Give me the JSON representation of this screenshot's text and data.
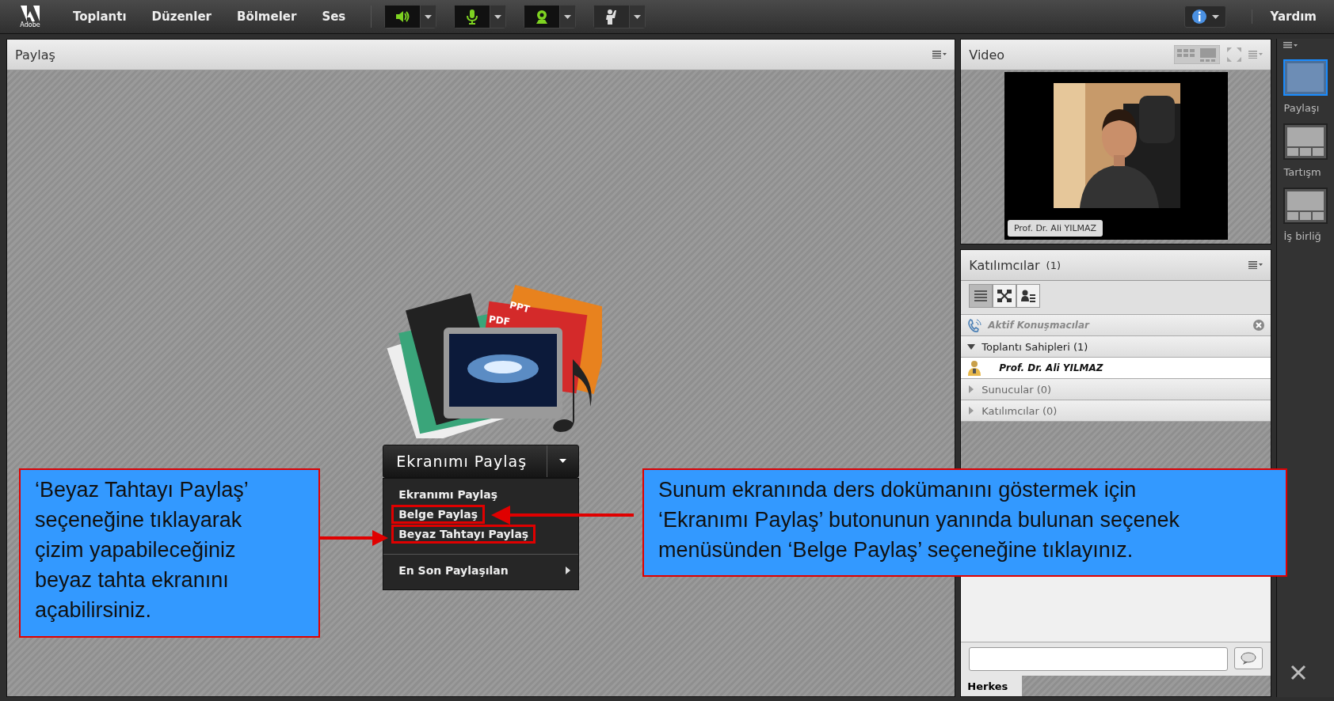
{
  "menu_bar": {
    "logo_text": "Adobe",
    "items": [
      "Toplantı",
      "Düzenler",
      "Bölmeler",
      "Ses"
    ],
    "help": "Yardım"
  },
  "toolbar": [
    {
      "kind": "speaker",
      "on": true
    },
    {
      "kind": "microphone",
      "on": true
    },
    {
      "kind": "camera",
      "on": true
    },
    {
      "kind": "hand",
      "on": false
    }
  ],
  "share_pod": {
    "title": "Paylaş",
    "media_labels": [
      "PPT",
      "PDF"
    ],
    "share_button": "Ekranımı Paylaş",
    "menu": [
      {
        "label": "Ekranımı Paylaş",
        "highlighted": false,
        "submenu": false
      },
      {
        "label": "Belge Paylaş",
        "highlighted": true,
        "submenu": false
      },
      {
        "label": "Beyaz Tahtayı Paylaş",
        "highlighted": true,
        "submenu": false
      },
      {
        "label": "En Son Paylaşılan",
        "highlighted": false,
        "submenu": true
      }
    ]
  },
  "video_pod": {
    "title": "Video",
    "name_tag": "Prof. Dr. Ali YILMAZ"
  },
  "attendees_pod": {
    "title": "Katılımcılar",
    "count": "(1)",
    "view_tabs": [
      {
        "kind": "list",
        "selected": true
      },
      {
        "kind": "breakout",
        "selected": false
      },
      {
        "kind": "detail",
        "selected": false
      }
    ],
    "active_speakers": "Aktif Konuşmacılar",
    "groups": [
      {
        "label": "Toplantı Sahipleri (1)",
        "expanded": true,
        "children": [
          {
            "label": "Prof. Dr. Ali YILMAZ"
          }
        ]
      },
      {
        "label": "Sunucular (0)",
        "expanded": false
      },
      {
        "label": "Katılımcılar (0)",
        "expanded": false
      }
    ],
    "chat_tab": "Herkes"
  },
  "layouts": [
    {
      "label": "Paylaşı",
      "kind": "share",
      "selected": true
    },
    {
      "label": "Tartışm",
      "kind": "discuss",
      "selected": false
    },
    {
      "label": "İş birliğ",
      "kind": "collab",
      "selected": false
    }
  ],
  "callouts": [
    {
      "text": "‘Beyaz Tahtayı Paylaş’\nseçeneğine tıklayarak\nçizim yapabileceğiniz\nbeyaz tahta ekranını\naçabilirsiniz."
    },
    {
      "text": "Sunum ekranında ders dokümanını göstermek için\n‘Ekranımı Paylaş’ butonunun yanında bulunan seçenek\nmenüsünden ‘Belge Paylaş’ seçeneğine tıklayınız."
    }
  ]
}
